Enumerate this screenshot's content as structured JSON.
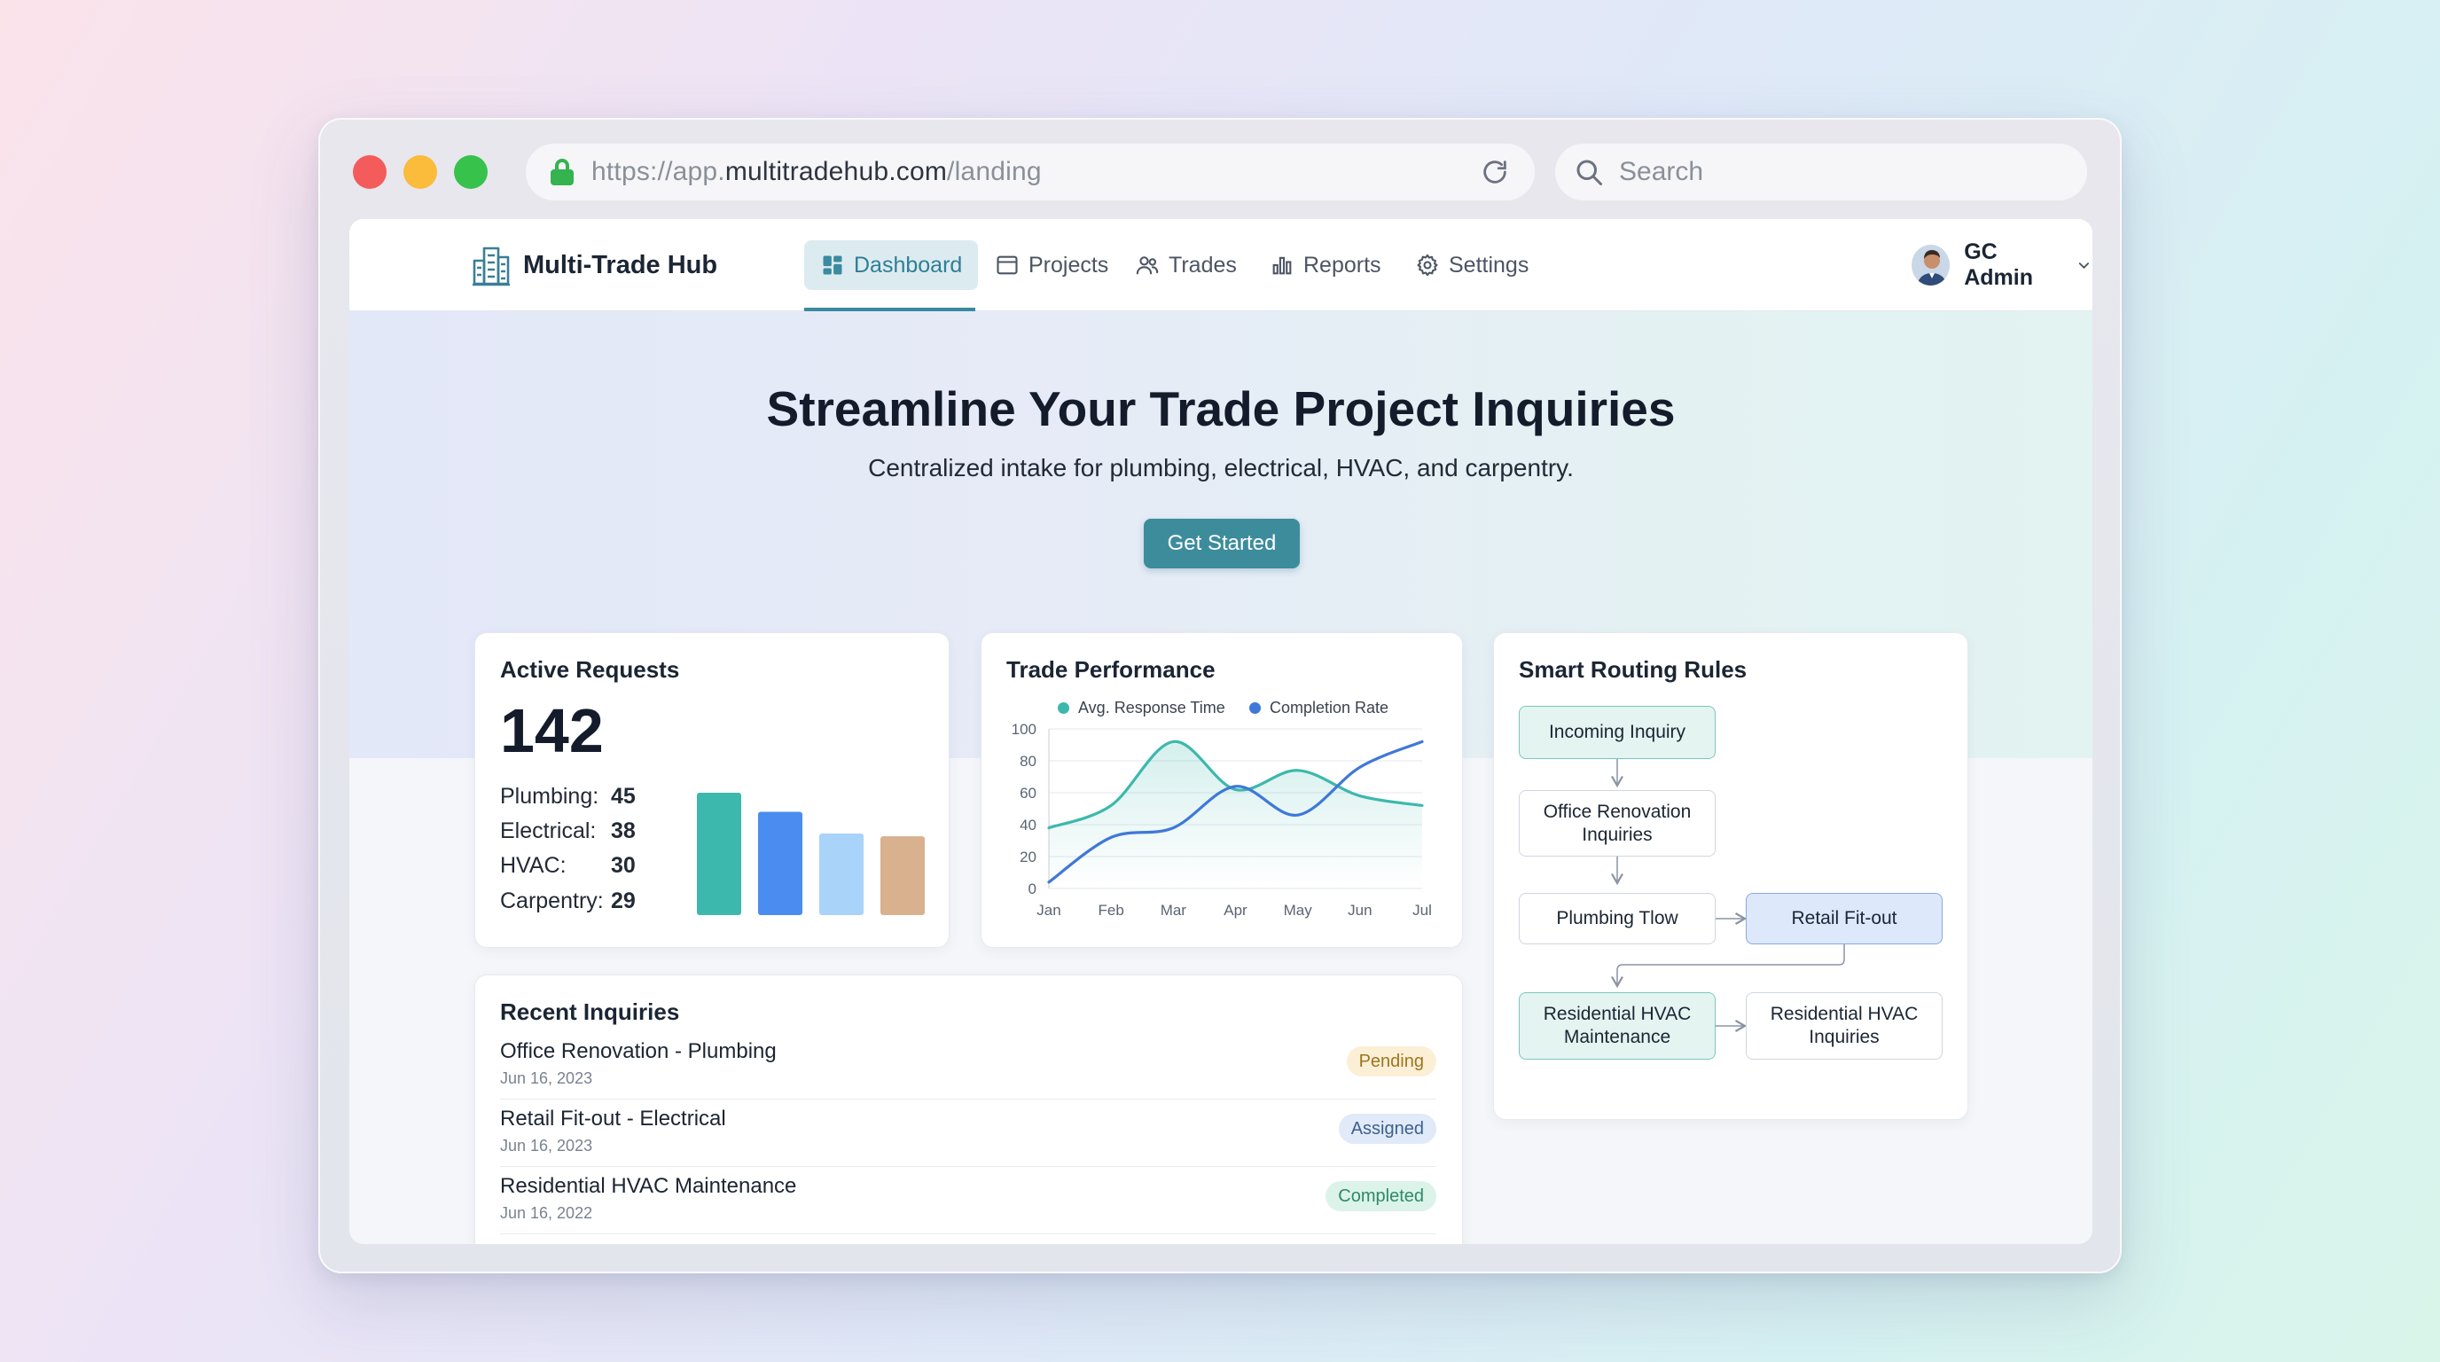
{
  "browser": {
    "url_prefix": "https://app.",
    "url_host": "multitradehub.com",
    "url_path": "/landing",
    "search_placeholder": "Search"
  },
  "nav": {
    "brand": "Multi-Trade Hub",
    "items": [
      {
        "label": "Dashboard",
        "icon": "dashboard-icon",
        "active": true
      },
      {
        "label": "Projects",
        "icon": "window-icon"
      },
      {
        "label": "Trades",
        "icon": "users-icon"
      },
      {
        "label": "Reports",
        "icon": "bar-chart-icon"
      },
      {
        "label": "Settings",
        "icon": "gear-icon"
      }
    ],
    "user": "GC Admin"
  },
  "hero": {
    "title": "Streamline Your Trade Project Inquiries",
    "subtitle": "Centralized intake for plumbing, electrical, HVAC, and carpentry.",
    "cta": "Get Started"
  },
  "active_requests": {
    "title": "Active Requests",
    "total": "142",
    "trades": [
      {
        "label": "Plumbing:",
        "value": "45",
        "color": "#3db8ad"
      },
      {
        "label": "Electrical:",
        "value": "38",
        "color": "#4a8cf0"
      },
      {
        "label": "HVAC:",
        "value": "30",
        "color": "#a9d3f8"
      },
      {
        "label": "Carpentry:",
        "value": "29",
        "color": "#d9b18e"
      }
    ]
  },
  "chart_data": {
    "type": "line",
    "title": "Trade Performance",
    "x": [
      "Jan",
      "Feb",
      "Mar",
      "Apr",
      "May",
      "Jun",
      "Jul"
    ],
    "yticks": [
      "100",
      "80",
      "60",
      "40",
      "20",
      "0"
    ],
    "ylim": [
      0,
      100
    ],
    "grid": true,
    "legend_position": "top",
    "series": [
      {
        "name": "Avg. Response Time",
        "color": "#3db8ad",
        "values": [
          38,
          52,
          92,
          62,
          74,
          58,
          52
        ]
      },
      {
        "name": "Completion Rate",
        "color": "#3f78d8",
        "values": [
          4,
          32,
          38,
          64,
          46,
          76,
          92
        ]
      }
    ]
  },
  "routing": {
    "title": "Smart Routing Rules",
    "nodes": {
      "incoming": "Incoming Inquiry",
      "office": "Office Renovation Inquiries",
      "plumbing": "Plumbing Tlow",
      "retail": "Retail Fit-out",
      "res_maint": "Residential HVAC Maintenance",
      "res_inq": "Residential HVAC Inquiries"
    }
  },
  "recent": {
    "title": "Recent Inquiries",
    "items": [
      {
        "title": "Office Renovation - Plumbing",
        "date": "Jun 16, 2023",
        "status": "Pending"
      },
      {
        "title": "Retail Fit-out - Electrical",
        "date": "Jun 16, 2023",
        "status": "Assigned"
      },
      {
        "title": "Residential HVAC Maintenance",
        "date": "Jun 16, 2022",
        "status": "Completed"
      }
    ]
  }
}
